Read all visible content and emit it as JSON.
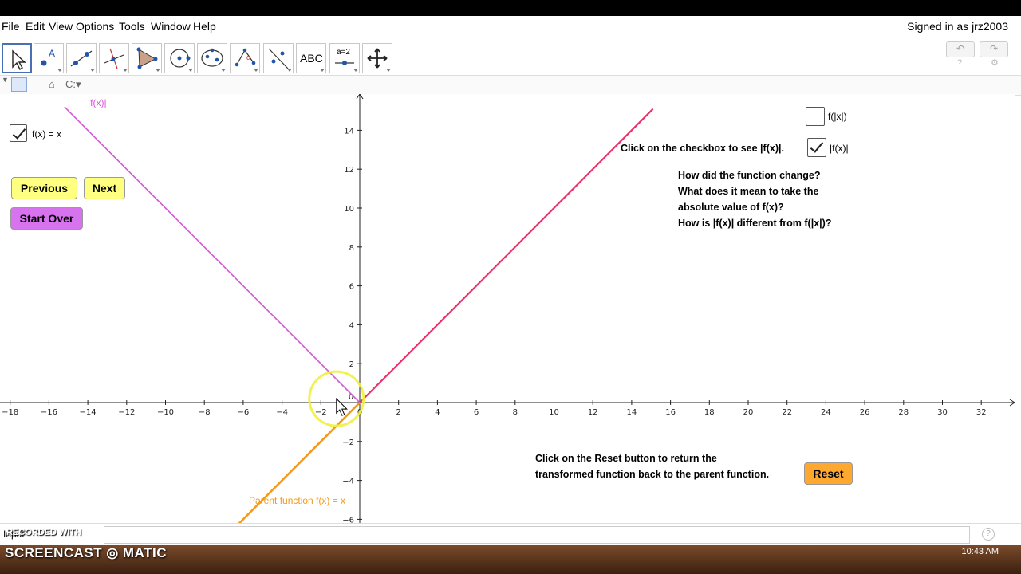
{
  "menu": {
    "items": [
      "File",
      "Edit",
      "View",
      "Options",
      "Tools",
      "Window",
      "Help"
    ],
    "signed_in": "Signed in as jrz2003"
  },
  "toolbar": {
    "tools": [
      "move-tool-icon",
      "point-tool-icon",
      "line-tool-icon",
      "perpendicular-tool-icon",
      "polygon-tool-icon",
      "circle-tool-icon",
      "conic-tool-icon",
      "angle-tool-icon",
      "reflect-tool-icon",
      "text-tool",
      "slider-tool",
      "move-graphics-tool-icon"
    ],
    "text_tool_label": "ABC",
    "slider_tool_label": "a=2",
    "undo": "↶",
    "redo": "↷"
  },
  "graph": {
    "label_abs_fx_curve": "|f(x)|",
    "checkbox_fx_label": "f(x) = x",
    "checkbox_fx_checked": true,
    "previous": "Previous",
    "next": "Next",
    "start_over": "Start Over",
    "checkbox_f_absx_label": "f(|x|)",
    "checkbox_f_absx_checked": false,
    "instruction_checkbox": "Click on the checkbox to see |f(x)|.",
    "checkbox_abs_fx_label": "|f(x)|",
    "checkbox_abs_fx_checked": true,
    "question_1": "How did the function change?",
    "question_2": "What does it mean to take the",
    "question_3": "absolute value of f(x)?",
    "question_4": "How is |f(x)| different from f(|x|)?",
    "reset_text_1": "Click on the Reset button to return the",
    "reset_text_2": "transformed function back to the parent function.",
    "reset": "Reset",
    "parent_label": "Parent function f(x) = x",
    "x_ticks": [
      -18,
      -16,
      -14,
      -12,
      -10,
      -8,
      -6,
      -4,
      -2,
      0,
      2,
      4,
      6,
      8,
      10,
      12,
      14,
      16,
      18,
      20,
      22,
      24,
      26,
      28,
      30,
      32
    ],
    "y_ticks": [
      14,
      12,
      10,
      8,
      6,
      4,
      2,
      -2,
      -4,
      -6
    ],
    "colors": {
      "abs_line": "#e8336a",
      "reflect_line": "#d656d8",
      "parent_line": "#f39a1a",
      "yellow_btn": "#ffff80",
      "purple_btn": "#d873f0",
      "orange_btn": "#ffa830"
    }
  },
  "input_bar": {
    "label": "Input:"
  },
  "watermark": {
    "line1": "RECORDED WITH",
    "line2": "SCREENCAST ◎ MATIC"
  },
  "clock": "10:43 AM"
}
